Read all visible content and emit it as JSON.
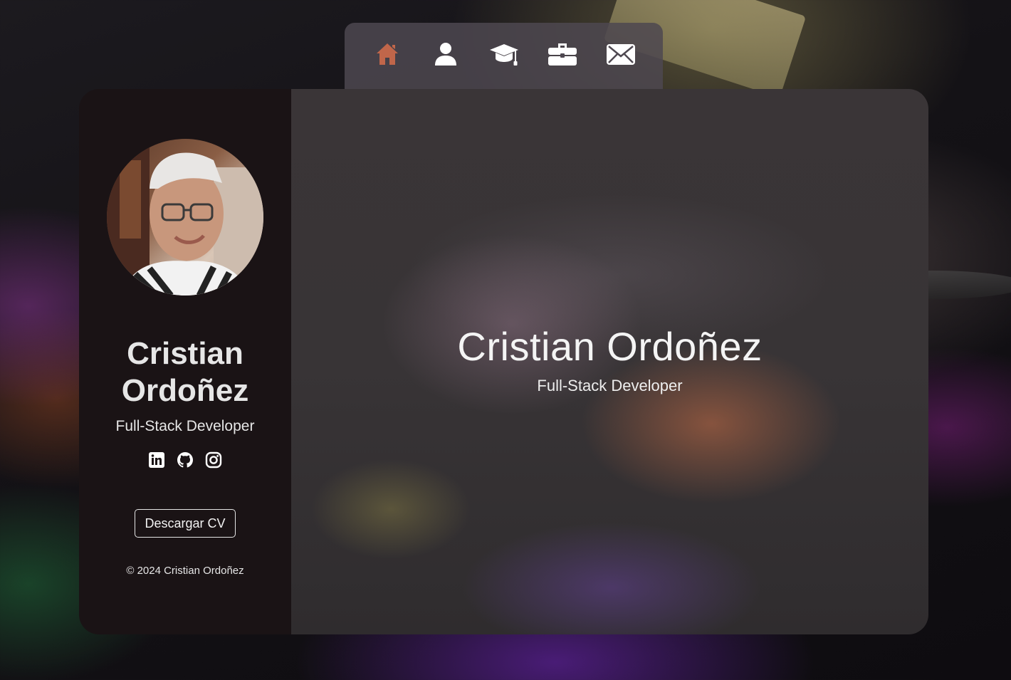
{
  "nav": {
    "items": [
      {
        "icon": "home-icon",
        "label": "Inicio",
        "active": true
      },
      {
        "icon": "user-icon",
        "label": "Sobre mí",
        "active": false
      },
      {
        "icon": "graduation-cap-icon",
        "label": "Educación",
        "active": false
      },
      {
        "icon": "briefcase-icon",
        "label": "Experiencia",
        "active": false
      },
      {
        "icon": "envelope-icon",
        "label": "Contacto",
        "active": false
      }
    ],
    "active_color": "#c0664a",
    "icon_color": "#ffffff"
  },
  "sidebar": {
    "name": "Cristian Ordoñez",
    "role": "Full-Stack Developer",
    "social": [
      {
        "icon": "linkedin-icon"
      },
      {
        "icon": "github-icon"
      },
      {
        "icon": "instagram-icon"
      }
    ],
    "cv_button": "Descargar CV",
    "copyright": "© 2024 Cristian Ordoñez"
  },
  "hero": {
    "name": "Cristian Ordoñez",
    "role": "Full-Stack Developer"
  }
}
